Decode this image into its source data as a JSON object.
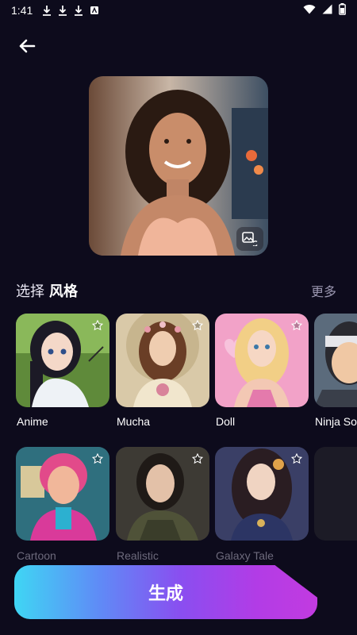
{
  "status_bar": {
    "time": "1:41",
    "icons": [
      "download-icon",
      "download-icon",
      "download-icon",
      "app-icon",
      "wifi-icon",
      "signal-icon",
      "battery-icon"
    ]
  },
  "header": {
    "back_icon": "arrow-left-icon"
  },
  "portrait": {
    "replace_icon": "image-swap-icon"
  },
  "style_section": {
    "title_prefix": "选择",
    "title_bold": "风格",
    "more_label": "更多",
    "row1": [
      {
        "label": "Anime"
      },
      {
        "label": "Mucha"
      },
      {
        "label": "Doll"
      },
      {
        "label": "Ninja So"
      }
    ],
    "row2": [
      {
        "label": "Cartoon"
      },
      {
        "label": "Realistic"
      },
      {
        "label": "Galaxy Tale"
      },
      {
        "label": ""
      }
    ]
  },
  "generate_button": {
    "label": "生成"
  },
  "colors": {
    "background": "#0d0b1c",
    "accent_start": "#3fd6f4",
    "accent_end": "#c23be0"
  }
}
